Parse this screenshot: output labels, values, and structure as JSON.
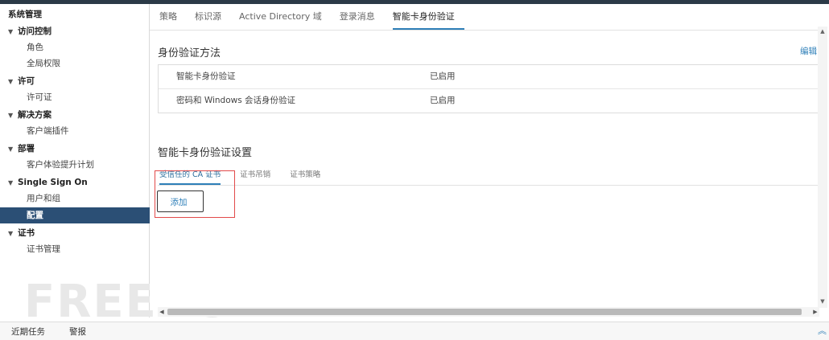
{
  "sidebar": {
    "title": "系统管理",
    "groups": [
      {
        "label": "访问控制",
        "items": [
          "角色",
          "全局权限"
        ]
      },
      {
        "label": "许可",
        "items": [
          "许可证"
        ]
      },
      {
        "label": "解决方案",
        "items": [
          "客户端插件"
        ]
      },
      {
        "label": "部署",
        "items": [
          "客户体验提升计划"
        ]
      },
      {
        "label": "Single Sign On",
        "items": [
          "用户和组",
          "配置"
        ]
      },
      {
        "label": "证书",
        "items": [
          "证书管理"
        ]
      }
    ],
    "selected_item": "配置"
  },
  "top_tabs": [
    "策略",
    "标识源",
    "Active Directory 域",
    "登录消息",
    "智能卡身份验证"
  ],
  "active_top_tab": "智能卡身份验证",
  "auth_methods": {
    "title": "身份验证方法",
    "edit_label": "编辑",
    "rows": [
      {
        "name": "智能卡身份验证",
        "status": "已启用"
      },
      {
        "name": "密码和 Windows 会话身份验证",
        "status": "已启用"
      }
    ]
  },
  "smartcard_settings": {
    "title": "智能卡身份验证设置",
    "subtabs": [
      "受信任的 CA 证书",
      "证书吊销",
      "证书策略"
    ],
    "active_subtab": "受信任的 CA 证书",
    "add_label": "添加"
  },
  "bottom_bar": {
    "recent_tasks": "近期任务",
    "alarms": "警报"
  },
  "watermark": "FREEBUF",
  "colors": {
    "accent": "#2e7fb8",
    "selected_bg": "#2b4f75",
    "highlight": "#e24a4a"
  }
}
